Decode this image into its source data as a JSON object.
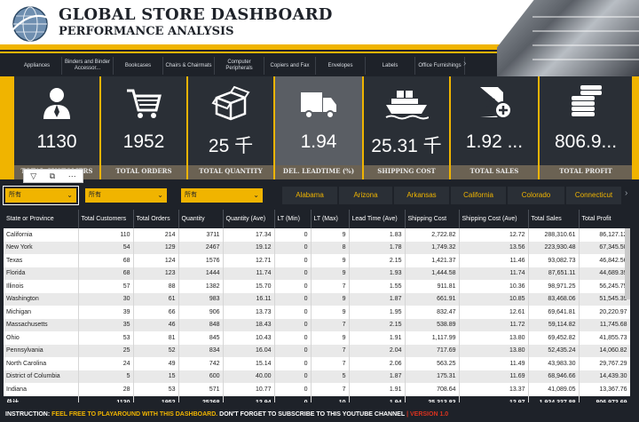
{
  "header": {
    "title": "GLOBAL STORE DASHBOARD",
    "subtitle": "PERFORMANCE ANALYSIS"
  },
  "categories": [
    "Appliances",
    "Binders and Binder Accessor...",
    "Bookcases",
    "Chairs & Chairmats",
    "Computer Peripherals",
    "Copiers and Fax",
    "Envelopes",
    "Labels",
    "Office Furnishings"
  ],
  "kpis": [
    {
      "value": "1130",
      "label": "TOTAL CUSTOMERS",
      "icon": "person-icon"
    },
    {
      "value": "1952",
      "label": "TOTAL ORDERS",
      "icon": "cart-icon"
    },
    {
      "value": "25 千",
      "label": "TOTAL QUANTITY",
      "icon": "box-icon"
    },
    {
      "value": "1.94",
      "label": "DEL. LEADTIME (%)",
      "icon": "truck-icon"
    },
    {
      "value": "25.31 千",
      "label": "SHIPPING COST",
      "icon": "ship-icon"
    },
    {
      "value": "1.92 ...",
      "label": "TOTAL SALES",
      "icon": "dollar-doc-icon"
    },
    {
      "value": "806.9...",
      "label": "TOTAL PROFIT",
      "icon": "coins-icon"
    }
  ],
  "visual_tools": [
    "filter-icon",
    "focus-mode-icon",
    "more-options-icon"
  ],
  "slicers": [
    {
      "value": "所有"
    },
    {
      "value": "所有"
    },
    {
      "value": "所有"
    }
  ],
  "states": [
    "Alabama",
    "Arizona",
    "Arkansas",
    "California",
    "Colorado",
    "Connecticut"
  ],
  "table": {
    "columns": [
      "State or Province",
      "Total Customers",
      "Total Orders",
      "Quantity",
      "Quantity (Ave)",
      "LT (Min)",
      "LT (Max)",
      "Lead Time (Ave)",
      "Shipping Cost",
      "Shipping Cost (Ave)",
      "Total Sales",
      "Total Profit"
    ],
    "rows": [
      [
        "California",
        "110",
        "214",
        "3711",
        "17.34",
        "0",
        "9",
        "1.83",
        "2,722.82",
        "12.72",
        "288,310.61",
        "86,127.12"
      ],
      [
        "New York",
        "54",
        "129",
        "2467",
        "19.12",
        "0",
        "8",
        "1.78",
        "1,749.32",
        "13.56",
        "223,930.48",
        "67,345.50"
      ],
      [
        "Texas",
        "68",
        "124",
        "1576",
        "12.71",
        "0",
        "9",
        "2.15",
        "1,421.37",
        "11.46",
        "93,082.73",
        "46,842.56"
      ],
      [
        "Florida",
        "68",
        "123",
        "1444",
        "11.74",
        "0",
        "9",
        "1.93",
        "1,444.58",
        "11.74",
        "87,651.11",
        "44,689.39"
      ],
      [
        "Illinois",
        "57",
        "88",
        "1382",
        "15.70",
        "0",
        "7",
        "1.55",
        "911.81",
        "10.36",
        "98,971.25",
        "56,245.75"
      ],
      [
        "Washington",
        "30",
        "61",
        "983",
        "16.11",
        "0",
        "9",
        "1.87",
        "661.91",
        "10.85",
        "83,468.06",
        "51,545.39"
      ],
      [
        "Michigan",
        "39",
        "66",
        "906",
        "13.73",
        "0",
        "9",
        "1.95",
        "832.47",
        "12.61",
        "69,641.81",
        "20,220.97"
      ],
      [
        "Massachusetts",
        "35",
        "46",
        "848",
        "18.43",
        "0",
        "7",
        "2.15",
        "538.89",
        "11.72",
        "59,114.82",
        "11,745.68"
      ],
      [
        "Ohio",
        "53",
        "81",
        "845",
        "10.43",
        "0",
        "9",
        "1.91",
        "1,117.99",
        "13.80",
        "69,452.82",
        "41,855.73"
      ],
      [
        "Pennsylvania",
        "25",
        "52",
        "834",
        "16.04",
        "0",
        "7",
        "2.04",
        "717.69",
        "13.80",
        "52,435.24",
        "14,060.82"
      ],
      [
        "North Carolina",
        "24",
        "49",
        "742",
        "15.14",
        "0",
        "7",
        "2.06",
        "563.25",
        "11.49",
        "43,983.30",
        "29,767.29"
      ],
      [
        "District of Columbia",
        "5",
        "15",
        "600",
        "40.00",
        "0",
        "5",
        "1.87",
        "175.31",
        "11.69",
        "68,946.66",
        "14,439.30"
      ],
      [
        "Indiana",
        "28",
        "53",
        "571",
        "10.77",
        "0",
        "7",
        "1.91",
        "708.64",
        "13.37",
        "41,089.05",
        "13,367.76"
      ]
    ],
    "total": [
      "总计",
      "1130",
      "1952",
      "25268",
      "12.94",
      "0",
      "10",
      "1.94",
      "25,313.83",
      "12.97",
      "1,924,337.88",
      "806,973.69"
    ]
  },
  "footer": {
    "lead": "INSTRUCTION:",
    "message": "FEEL FREE TO PLAYAROUND WITH THIS DASHBOARD.",
    "message2": "DON'T FORGET TO SUBSCRIBE TO THIS YOUTUBE CHANNEL",
    "separator": "|",
    "version": "VERSION 1.0"
  },
  "colors": {
    "accent": "#f0b400",
    "dark": "#1e2229",
    "tile": "#2a2f36",
    "version": "#d9321f"
  }
}
